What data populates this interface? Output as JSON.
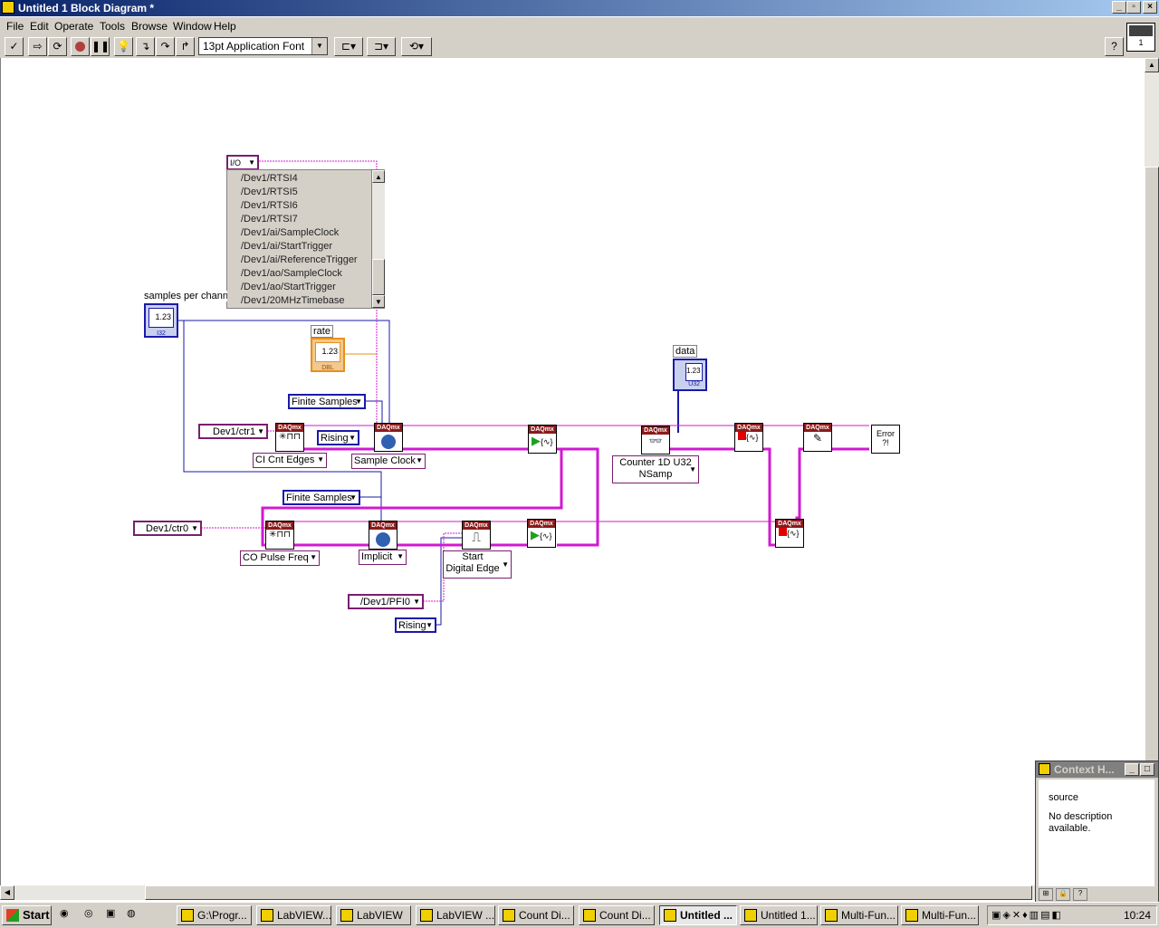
{
  "window": {
    "title": "Untitled 1 Block Diagram *"
  },
  "menu": [
    "File",
    "Edit",
    "Operate",
    "Tools",
    "Browse",
    "Window",
    "Help"
  ],
  "toolbar": {
    "font": "13pt Application Font",
    "vi_number": "1"
  },
  "diagram": {
    "dropdown_list": {
      "items": [
        "/Dev1/RTSI4",
        "/Dev1/RTSI5",
        "/Dev1/RTSI6",
        "/Dev1/RTSI7",
        "/Dev1/ai/SampleClock",
        "/Dev1/ai/StartTrigger",
        "/Dev1/ai/ReferenceTrigger",
        "/Dev1/ao/SampleClock",
        "/Dev1/ao/StartTrigger",
        "/Dev1/20MHzTimebase"
      ]
    },
    "samples_label": "samples per chann",
    "rate_label": "rate",
    "data_label": "data",
    "num_value": "1.23",
    "i32": "I32",
    "dbl": "DBL",
    "u32": "U32",
    "finite_samples_1": "Finite Samples",
    "finite_samples_2": "Finite Samples",
    "dev1_ctr1": "Dev1/ctr1",
    "dev1_ctr0": "Dev1/ctr0",
    "rising_1": "Rising",
    "rising_2": "Rising",
    "ci_cnt_edges": "CI Cnt Edges",
    "sample_clock": "Sample Clock",
    "counter_read_line1": "Counter 1D U32",
    "counter_read_line2": "NSamp",
    "co_pulse_freq": "CO Pulse Freq",
    "implicit": "Implicit",
    "start_line1": "Start",
    "start_line2": "Digital Edge",
    "pfi0": "/Dev1/PFI0",
    "daqmx": "DAQmx",
    "error": "Error"
  },
  "context_help": {
    "title": "Context H...",
    "item": "source",
    "description": "No description available."
  },
  "taskbar": {
    "start": "Start",
    "tasks": [
      "G:\\Progr...",
      "LabVIEW...",
      "LabVIEW",
      "LabVIEW ...",
      "Count Di...",
      "Count Di...",
      "Untitled ...",
      "Untitled 1...",
      "Multi-Fun...",
      "Multi-Fun..."
    ],
    "clock": "10:24"
  },
  "colors": {
    "wire_pink": "#d01ad0",
    "wire_blue": "#1a1aa8",
    "wire_orange": "#e8901a",
    "daqmx_header": "#8b1a1a"
  }
}
